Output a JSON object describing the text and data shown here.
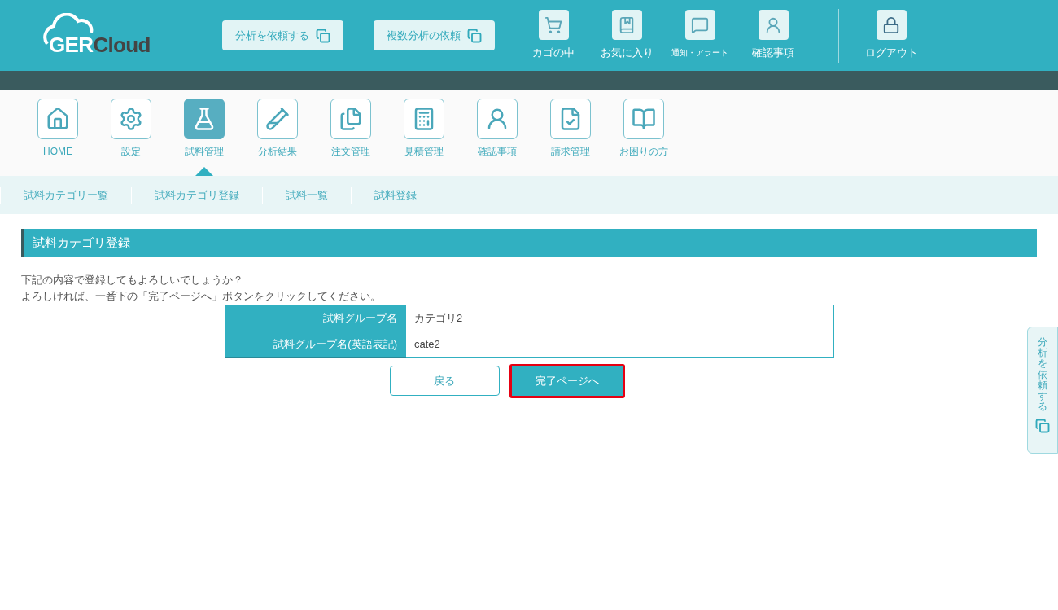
{
  "logo": {
    "part_1": "GER",
    "part_2": "Cloud"
  },
  "header_buttons": [
    {
      "label": "分析を依頼する"
    },
    {
      "label": "複数分析の依頼"
    }
  ],
  "header_icons": [
    {
      "kind": "cart",
      "label": "カゴの中",
      "small": false
    },
    {
      "kind": "favorite",
      "label": "お気に入り",
      "small": false
    },
    {
      "kind": "alert",
      "label": "通知・アラート",
      "small": true
    },
    {
      "kind": "confirm",
      "label": "確認事項",
      "small": false
    }
  ],
  "logout": {
    "label": "ログアウト"
  },
  "nav": [
    {
      "kind": "home",
      "label": "HOME",
      "selected": false
    },
    {
      "kind": "settings",
      "label": "設定",
      "selected": false
    },
    {
      "kind": "flask",
      "label": "試料管理",
      "selected": true
    },
    {
      "kind": "result",
      "label": "分析結果",
      "selected": false
    },
    {
      "kind": "orders",
      "label": "注文管理",
      "selected": false
    },
    {
      "kind": "calc",
      "label": "見積管理",
      "selected": false
    },
    {
      "kind": "confirm",
      "label": "確認事項",
      "selected": false
    },
    {
      "kind": "invoice",
      "label": "請求管理",
      "selected": false
    },
    {
      "kind": "help",
      "label": "お困りの方",
      "selected": false
    }
  ],
  "submenu": [
    "試料カテゴリー覧",
    "試料カテゴリ登録",
    "試料一覧",
    "試料登録"
  ],
  "section_title": "試料カテゴリ登録",
  "message": [
    "下記の内容で登録してもよろしいでしょうか？",
    "よろしければ、一番下の「完了ページへ」ボタンをクリックしてください。"
  ],
  "table": [
    {
      "label": "試料グループ名",
      "value": "カテゴリ2"
    },
    {
      "label": "試料グループ名(英語表記)",
      "value": "cate2"
    }
  ],
  "buttons": {
    "back": {
      "label": "戻る"
    },
    "submit": {
      "label": "完了ページへ",
      "highlighted": true
    }
  },
  "side_tab": {
    "label": "分析を依頼する"
  }
}
